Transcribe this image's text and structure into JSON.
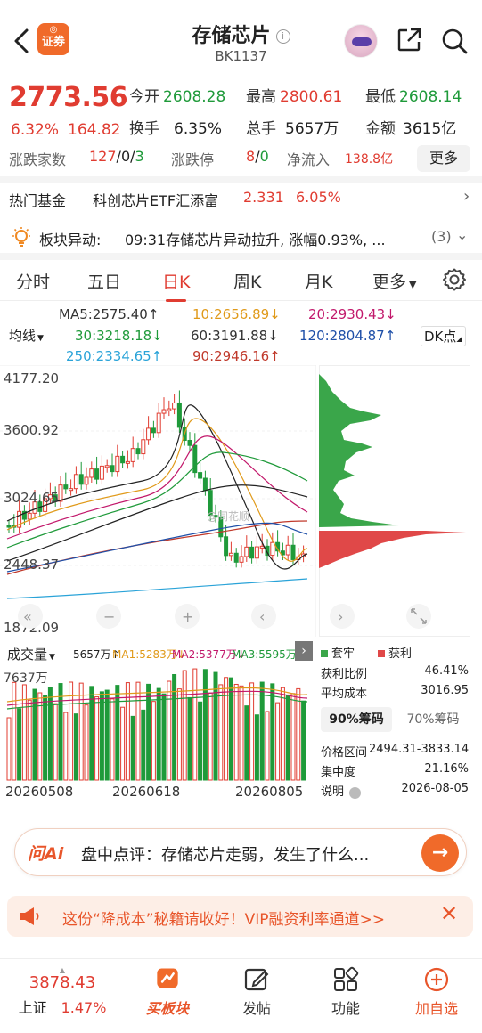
{
  "header": {
    "logo_text": "证券",
    "title": "存储芯片",
    "code": "BK1137"
  },
  "quote": {
    "price": "2773.56",
    "pct": "6.32%",
    "change": "164.82",
    "open_label": "今开",
    "open": "2608.28",
    "high_label": "最高",
    "high": "2800.61",
    "low_label": "最低",
    "low": "2608.14",
    "turnover_label": "换手",
    "turnover": "6.35%",
    "volume_label": "总手",
    "volume": "5657万",
    "amount_label": "金额",
    "amount": "3615亿"
  },
  "sector": {
    "updown_label": "涨跌家数",
    "up": "127",
    "flat": "0",
    "down": "3",
    "limit_label": "涨跌停",
    "limit_up": "8",
    "limit_down": "0",
    "inflow_label": "净流入",
    "inflow": "138.8亿",
    "more": "更多"
  },
  "fund": {
    "label": "热门基金",
    "name": "科创芯片ETF汇添富",
    "nav": "2.331",
    "pct": "6.05%"
  },
  "alert": {
    "label": "板块异动:",
    "text": "09:31存储芯片异动拉升, 涨幅0.93%, ...",
    "count": "(3)"
  },
  "tabs": [
    "分时",
    "五日",
    "日K",
    "周K",
    "月K",
    "更多"
  ],
  "ma": {
    "selector": "均线",
    "dk": "DK点",
    "items": [
      {
        "text": "MA5:2575.40↑",
        "color": "#333333"
      },
      {
        "text": "10:2656.89↓",
        "color": "#e09a1a"
      },
      {
        "text": "20:2930.43↓",
        "color": "#c2186b"
      },
      {
        "text": "30:3218.18↓",
        "color": "#1f9a3a"
      },
      {
        "text": "60:3191.88↓",
        "color": "#333333"
      },
      {
        "text": "120:2804.87↑",
        "color": "#1e4fa8"
      },
      {
        "text": "250:2334.65↑",
        "color": "#2aa3d8"
      },
      {
        "text": "90:2946.16↑",
        "color": "#c0392b"
      }
    ]
  },
  "kchart": {
    "y_labels": [
      "4177.20",
      "3600.92",
      "3024.65",
      "2448.37",
      "1872.09"
    ],
    "watermark": "@同花顺"
  },
  "volume": {
    "label": "成交量",
    "value": "5657万↑",
    "ma1": "MA1:5283万↓",
    "ma2": "MA2:5377万↓",
    "ma3": "MA3:5595万↓",
    "top_label": "7637万",
    "dates": [
      "20260508",
      "20260618",
      "20260805"
    ]
  },
  "chip": {
    "legend_lock": "套牢",
    "legend_profit": "获利",
    "profit_ratio_label": "获利比例",
    "profit_ratio": "46.41%",
    "avg_cost_label": "平均成本",
    "avg_cost": "3016.95",
    "tab_90": "90%筹码",
    "tab_70": "70%筹码",
    "range_label": "价格区间",
    "range": "2494.31-3833.14",
    "concentration_label": "集中度",
    "concentration": "21.16%",
    "note_label": "说明",
    "date": "2026-08-05"
  },
  "ai": {
    "logo": "问Ai",
    "text": "盘中点评：存储芯片走弱，发生了什么..."
  },
  "promo": {
    "text": "这份“降成本”秘籍请收好！VIP融资利率通道>>"
  },
  "bottom": {
    "index_value": "3878.43",
    "index_name": "上证",
    "index_pct": "1.47%",
    "buy": "买板块",
    "post": "发帖",
    "func": "功能",
    "add": "加自选"
  },
  "colors": {
    "up": "#e03c31",
    "down": "#1f9a3a",
    "accent": "#e03c31"
  }
}
